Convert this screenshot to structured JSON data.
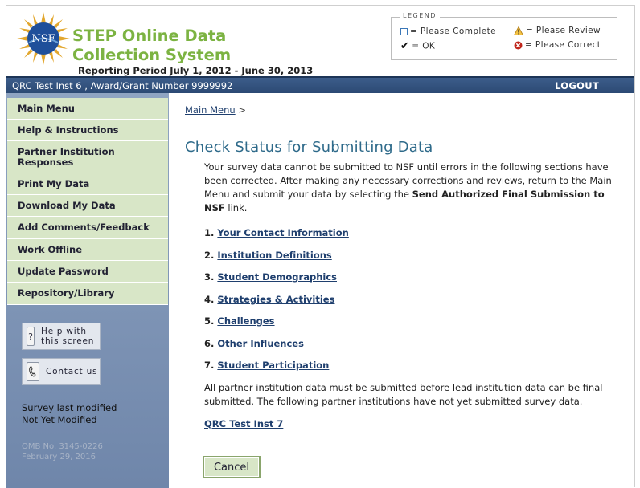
{
  "header": {
    "title": "STEP Online Data Collection System",
    "reporting_period": "Reporting Period July 1, 2012 - June 30, 2013",
    "logo_text": "NSF"
  },
  "legend": {
    "title": "LEGEND",
    "complete": "= Please Complete",
    "ok": "= OK",
    "review": "= Please Review",
    "correct": "= Please Correct"
  },
  "bar": {
    "institution": "QRC Test Inst 6 , Award/Grant Number 9999992",
    "logout": "LOGOUT"
  },
  "sidebar": {
    "items": [
      {
        "label": "Main Menu"
      },
      {
        "label": "Help & Instructions"
      },
      {
        "label": "Partner Institution Responses"
      },
      {
        "label": "Print My Data"
      },
      {
        "label": "Download My Data"
      },
      {
        "label": "Add Comments/Feedback"
      },
      {
        "label": "Work Offline"
      },
      {
        "label": "Update Password"
      },
      {
        "label": "Repository/Library"
      }
    ],
    "help_button": "Help with this screen",
    "contact_button": "Contact us",
    "survey_modified_label": "Survey last modified",
    "survey_modified_value": "Not Yet Modified",
    "omb_number": "OMB No. 3145-0226",
    "omb_date": "February 29, 2016"
  },
  "main": {
    "breadcrumb": "Main Menu",
    "breadcrumb_sep": ">",
    "title": "Check Status for Submitting Data",
    "intro_before": "Your survey data cannot be submitted to NSF until errors in the following sections have been corrected. After making any necessary corrections and reviews, return to the Main Menu and submit your data by selecting the ",
    "intro_bold": "Send Authorized Final Submission to NSF",
    "intro_after": " link.",
    "sections": [
      {
        "num": "1.",
        "label": "Your Contact Information"
      },
      {
        "num": "2.",
        "label": "Institution Definitions"
      },
      {
        "num": "3.",
        "label": "Student Demographics"
      },
      {
        "num": "4.",
        "label": "Strategies & Activities"
      },
      {
        "num": "5.",
        "label": "Challenges"
      },
      {
        "num": "6.",
        "label": "Other Influences"
      },
      {
        "num": "7.",
        "label": "Student Participation"
      }
    ],
    "partner_text": "All partner institution data must be submitted before lead institution data can be final submitted. The following partner institutions have not yet submitted survey data.",
    "partner_link": "QRC Test Inst 7",
    "cancel": "Cancel"
  }
}
